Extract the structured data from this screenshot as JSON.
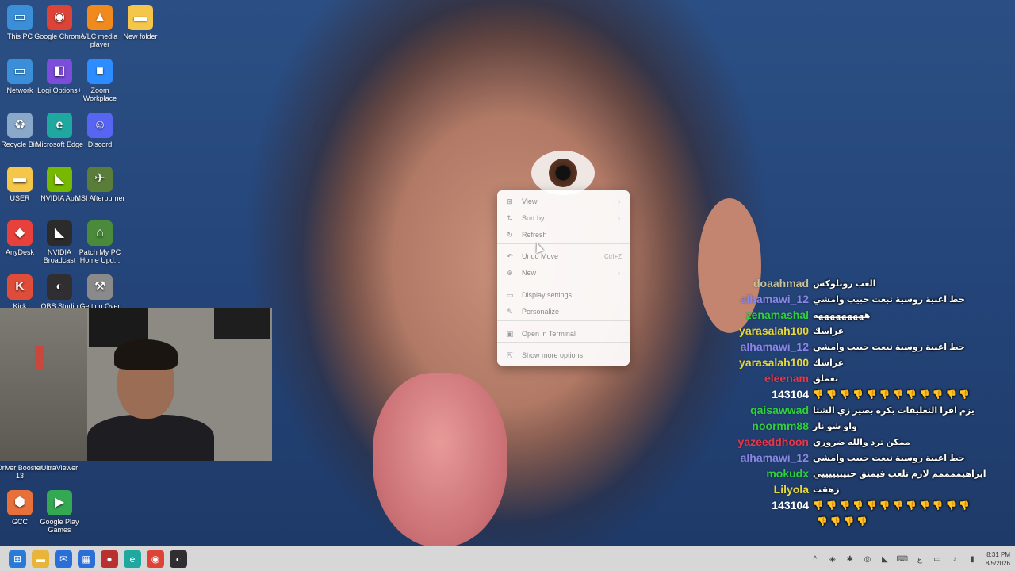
{
  "desktop_icons": [
    {
      "label": "This PC",
      "icon": "monitor-icon",
      "color": "#3a8fd8"
    },
    {
      "label": "Google Chrome",
      "icon": "chrome-icon",
      "color": "#db4437"
    },
    {
      "label": "VLC media player",
      "icon": "vlc-icon",
      "color": "#f08a1c"
    },
    {
      "label": "New folder",
      "icon": "folder-icon",
      "color": "#f4c64a"
    },
    {
      "label": "Network",
      "icon": "network-icon",
      "color": "#3a8fd8"
    },
    {
      "label": "Logi Options+",
      "icon": "logi-icon",
      "color": "#7c4ddb"
    },
    {
      "label": "Zoom Workplace",
      "icon": "zoom-icon",
      "color": "#2d8cff"
    },
    {
      "label": "Recycle Bin",
      "icon": "recycle-bin-icon",
      "color": "#8aa8c8"
    },
    {
      "label": "Microsoft Edge",
      "icon": "edge-icon",
      "color": "#1fa8a0"
    },
    {
      "label": "Discord",
      "icon": "discord-icon",
      "color": "#5865f2"
    },
    {
      "label": "USER",
      "icon": "folder-icon",
      "color": "#f4c64a"
    },
    {
      "label": "NVIDIA App",
      "icon": "nvidia-icon",
      "color": "#76b900"
    },
    {
      "label": "MSI Afterburner",
      "icon": "msi-afterburner-icon",
      "color": "#5a7d3a"
    },
    {
      "label": "AnyDesk",
      "icon": "anydesk-icon",
      "color": "#e8413c"
    },
    {
      "label": "NVIDIA Broadcast",
      "icon": "nvidia-broadcast-icon",
      "color": "#2b2b2b"
    },
    {
      "label": "Patch My PC Home Upd...",
      "icon": "patchmypc-icon",
      "color": "#4a8a3a"
    },
    {
      "label": "Kick",
      "icon": "kick-icon",
      "color": "#e04c3a"
    },
    {
      "label": "OBS Studio",
      "icon": "obs-icon",
      "color": "#302e31"
    },
    {
      "label": "Getting Over",
      "icon": "hammer-icon",
      "color": "#8a8a8a"
    },
    {
      "label": "Driver Booster 13",
      "icon": "driver-booster-icon",
      "color": "#e53935"
    },
    {
      "label": "UltraViewer",
      "icon": "ultraviewer-icon",
      "color": "#2a6fd8"
    },
    {
      "label": "GCC",
      "icon": "gcc-icon",
      "color": "#e8703a"
    },
    {
      "label": "Google Play Games",
      "icon": "play-games-icon",
      "color": "#34a853"
    }
  ],
  "context_menu": {
    "items": [
      {
        "label": "View",
        "icon": "grid-icon",
        "submenu": true
      },
      {
        "label": "Sort by",
        "icon": "sort-icon",
        "submenu": true
      },
      {
        "label": "Refresh",
        "icon": "refresh-icon"
      },
      {
        "label": "Undo Move",
        "icon": "undo-icon",
        "shortcut": "Ctrl+Z"
      },
      {
        "label": "New",
        "icon": "plus-circle-icon",
        "submenu": true
      },
      {
        "label": "Display settings",
        "icon": "display-icon"
      },
      {
        "label": "Personalize",
        "icon": "brush-icon"
      },
      {
        "label": "Open in Terminal",
        "icon": "terminal-icon"
      },
      {
        "label": "Show more options",
        "icon": "share-icon"
      }
    ]
  },
  "chat": [
    {
      "user": "doaahmad",
      "color": "#c8c19a",
      "message": "العب روبلوكس"
    },
    {
      "user": "alhamawi_12",
      "color": "#8a86e8",
      "message": "حط اغنية روسية تبعت حبيب وامشي"
    },
    {
      "user": "zenamashal",
      "color": "#2fd13a",
      "message": "هههههههههه"
    },
    {
      "user": "yarasalah100",
      "color": "#e8d83a",
      "message": "عراسك"
    },
    {
      "user": "alhamawi_12",
      "color": "#8a86e8",
      "message": "حط اغنية روسية تبعت حبيب وامشي"
    },
    {
      "user": "yarasalah100",
      "color": "#e8d83a",
      "message": "عراسك"
    },
    {
      "user": "eleenam",
      "color": "#e8364a",
      "message": "بعملق"
    },
    {
      "user": "143104",
      "color": "#ffffff",
      "message": "👎 👎 👎 👎 👎 👎 👎 👎 👎 👎 👎 👎"
    },
    {
      "user": "qaisawwad",
      "color": "#2fd13a",
      "message": "يزم اقرا التعليقات بكره بصير زي الشتا"
    },
    {
      "user": "noormm88",
      "color": "#2fd13a",
      "message": "واو شو نار"
    },
    {
      "user": "yazeeddhoon",
      "color": "#e8364a",
      "message": "ممكن ترد والله ضروري"
    },
    {
      "user": "alhamawi_12",
      "color": "#8a86e8",
      "message": "حط اغنية روسية تبعت حبيب وامشي"
    },
    {
      "user": "mokudx",
      "color": "#2fd13a",
      "message": "ابراهيممممم لازم تلعب قيمنق حبيبيييييي"
    },
    {
      "user": "Lilyola",
      "color": "#e8d83a",
      "message": "زهقت"
    },
    {
      "user": "143104",
      "color": "#ffffff",
      "message": "👎 👎 👎 👎 👎 👎 👎 👎 👎 👎 👎 👎"
    },
    {
      "user": "",
      "color": "#ffffff",
      "message": "👎 👎 👎 👎"
    }
  ],
  "taskbar": {
    "apps": [
      {
        "name": "start-icon",
        "glyph": "⊞",
        "color": "#2a7bd8"
      },
      {
        "name": "file-explorer-icon",
        "glyph": "▬",
        "color": "#e8b43a"
      },
      {
        "name": "outlook-icon",
        "glyph": "✉",
        "color": "#2a6fd8"
      },
      {
        "name": "store-icon",
        "glyph": "▦",
        "color": "#2a6fd8"
      },
      {
        "name": "app-red-icon",
        "glyph": "●",
        "color": "#b83030"
      },
      {
        "name": "edge-icon",
        "glyph": "e",
        "color": "#1fa8a0"
      },
      {
        "name": "chrome-icon",
        "glyph": "◉",
        "color": "#db4437"
      },
      {
        "name": "obs-icon",
        "glyph": "◐",
        "color": "#302e31"
      }
    ],
    "tray": {
      "icons": [
        "chevron-up-icon",
        "shield-icon",
        "settings-icon",
        "steam-icon",
        "nvidia-tray-icon",
        "keyboard-icon",
        "language-icon",
        "monitor-icon",
        "volume-icon",
        "battery-icon"
      ],
      "lang": "ع",
      "time": "8:31 PM",
      "date": "8/5/2026"
    }
  }
}
